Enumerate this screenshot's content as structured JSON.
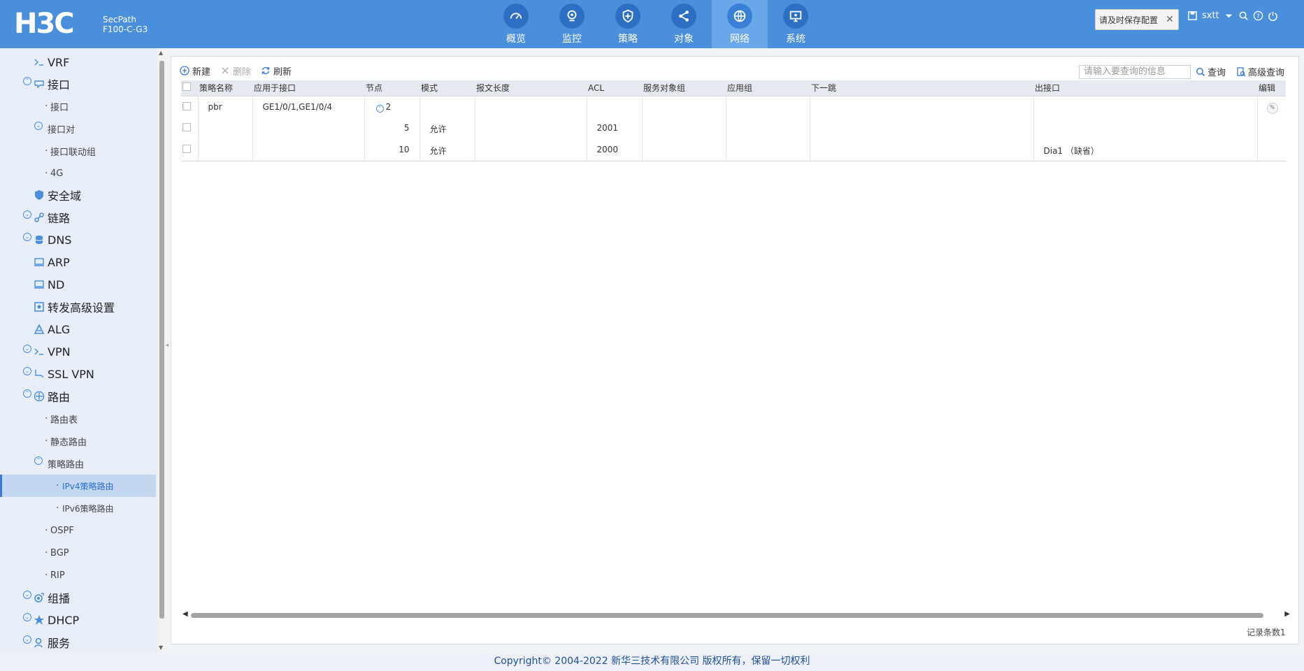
{
  "brand": {
    "logo": "H3C",
    "product_line1": "SecPath",
    "product_line2": "F100-C-G3"
  },
  "nav": [
    {
      "label": "概览",
      "icon": "dashboard-icon"
    },
    {
      "label": "监控",
      "icon": "monitor-icon"
    },
    {
      "label": "策略",
      "icon": "shield-icon"
    },
    {
      "label": "对象",
      "icon": "share-icon"
    },
    {
      "label": "网络",
      "icon": "globe-icon",
      "active": true
    },
    {
      "label": "系统",
      "icon": "system-icon"
    }
  ],
  "toast": {
    "text": "请及时保存配置",
    "close": "✕"
  },
  "user": {
    "name": "sxtt"
  },
  "sidebar": {
    "items": [
      {
        "label": "VRF"
      },
      {
        "label": "接口"
      },
      {
        "label": "接口"
      },
      {
        "label": "接口对"
      },
      {
        "label": "接口联动组"
      },
      {
        "label": "4G"
      },
      {
        "label": "安全域"
      },
      {
        "label": "链路"
      },
      {
        "label": "DNS"
      },
      {
        "label": "ARP"
      },
      {
        "label": "ND"
      },
      {
        "label": "转发高级设置"
      },
      {
        "label": "ALG"
      },
      {
        "label": "VPN"
      },
      {
        "label": "SSL VPN"
      },
      {
        "label": "路由"
      },
      {
        "label": "路由表"
      },
      {
        "label": "静态路由"
      },
      {
        "label": "策略路由"
      },
      {
        "label": "IPv4策略路由"
      },
      {
        "label": "IPv6策略路由"
      },
      {
        "label": "OSPF"
      },
      {
        "label": "BGP"
      },
      {
        "label": "RIP"
      },
      {
        "label": "组播"
      },
      {
        "label": "DHCP"
      },
      {
        "label": "服务"
      }
    ]
  },
  "toolbar": {
    "new": "新建",
    "delete": "删除",
    "refresh": "刷新"
  },
  "search": {
    "placeholder": "请输入要查询的信息",
    "button": "查询",
    "advanced": "高级查询"
  },
  "table": {
    "headers": [
      "策略名称",
      "应用于接口",
      "节点",
      "模式",
      "报文长度",
      "ACL",
      "服务对象组",
      "应用组",
      "下一跳",
      "出接口",
      "编辑"
    ],
    "rows": [
      {
        "name": "pbr",
        "interface": "GE1/0/1,GE1/0/4",
        "node": "2",
        "mode": "",
        "length": "",
        "acl": "",
        "service": "",
        "app": "",
        "nexthop": "",
        "out": ""
      },
      {
        "name": "",
        "interface": "",
        "node": "5",
        "mode": "允许",
        "length": "",
        "acl": "2001",
        "service": "",
        "app": "",
        "nexthop": "",
        "out": ""
      },
      {
        "name": "",
        "interface": "",
        "node": "10",
        "mode": "允许",
        "length": "",
        "acl": "2000",
        "service": "",
        "app": "",
        "nexthop": "",
        "out": "Dia1 （缺省）"
      }
    ]
  },
  "record_count": "记录条数1",
  "footer": "Copyright© 2004-2022 新华三技术有限公司 版权所有，保留一切权利"
}
